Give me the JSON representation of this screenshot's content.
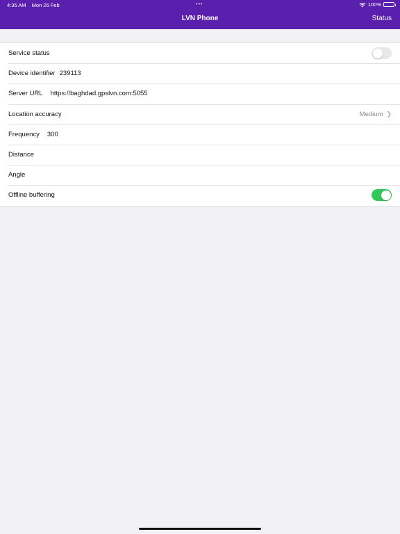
{
  "statusbar": {
    "time": "4:35 AM",
    "date": "Mon 26 Feb",
    "dots": "•••",
    "battery": "100%"
  },
  "nav": {
    "title": "LVN Phone",
    "right_button": "Status",
    "color": "#5a1fad"
  },
  "rows": {
    "service_status": {
      "label": "Service status",
      "toggle_on": false
    },
    "device_identifier": {
      "label": "Device identifier",
      "value": "239113"
    },
    "server_url": {
      "label": "Server URL",
      "value": "https://baghdad.gpslvn.com:5055"
    },
    "location_accuracy": {
      "label": "Location accuracy",
      "value": "Medium"
    },
    "frequency": {
      "label": "Frequency",
      "value": "300"
    },
    "distance": {
      "label": "Distance",
      "value": ""
    },
    "angle": {
      "label": "Angle",
      "value": ""
    },
    "offline_buffering": {
      "label": "Offline buffering",
      "toggle_on": true
    }
  },
  "colors": {
    "toggle_on": "#34c759",
    "toggle_off": "#e9e9eb",
    "background": "#f2f1f6"
  },
  "icons": [
    "wifi-icon",
    "battery-icon",
    "chevron-right-icon"
  ]
}
